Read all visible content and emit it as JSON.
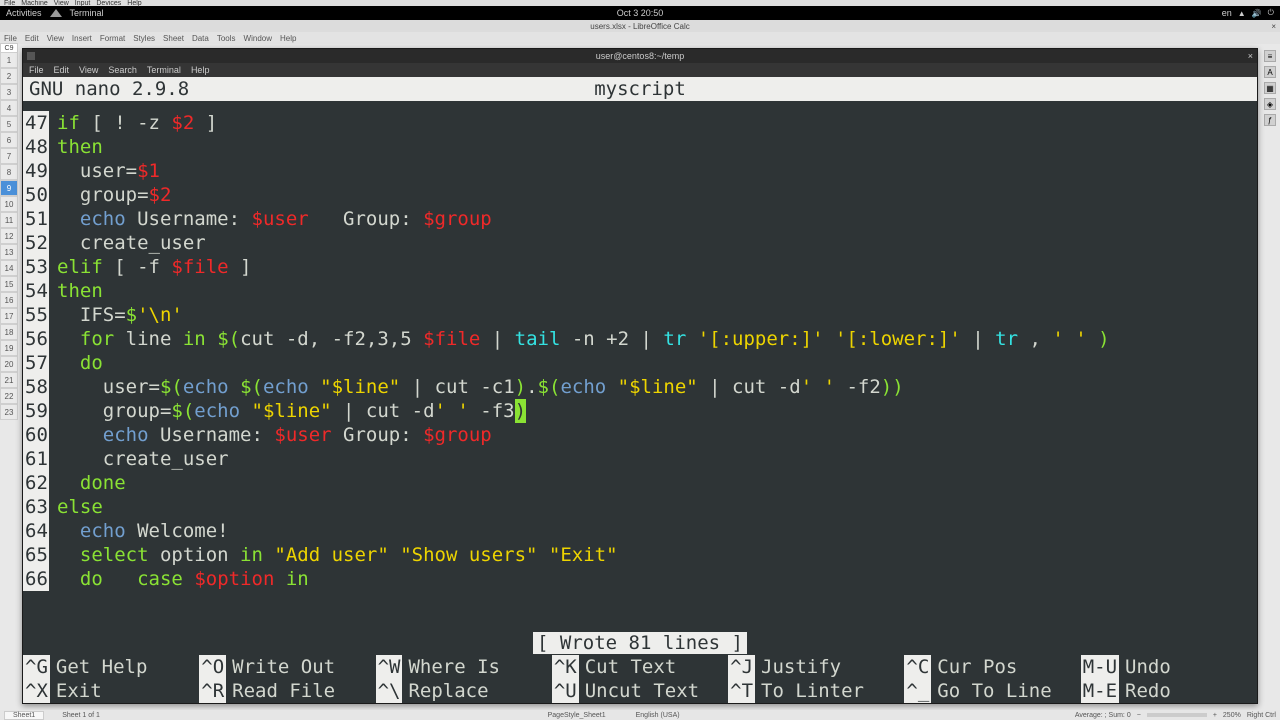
{
  "vm_menu": [
    "File",
    "Machine",
    "View",
    "Input",
    "Devices",
    "Help"
  ],
  "gnome": {
    "activities": "Activities",
    "app": "Terminal",
    "clock": "Oct 3  20:50",
    "lang": "en"
  },
  "libreoffice": {
    "title": "users.xlsx - LibreOffice Calc",
    "menu": [
      "File",
      "Edit",
      "View",
      "Insert",
      "Format",
      "Styles",
      "Sheet",
      "Data",
      "Tools",
      "Window",
      "Help"
    ],
    "cellref": "C9",
    "rows": [
      "1",
      "2",
      "3",
      "4",
      "5",
      "6",
      "7",
      "8",
      "9",
      "10",
      "11",
      "12",
      "13",
      "14",
      "15",
      "16",
      "17",
      "18",
      "19",
      "20",
      "21",
      "22",
      "23"
    ],
    "selected_row": "9"
  },
  "terminal": {
    "title": "user@centos8:~/temp",
    "menu": [
      "File",
      "Edit",
      "View",
      "Search",
      "Terminal",
      "Help"
    ]
  },
  "nano": {
    "app": "GNU nano 2.9.8",
    "filename": "myscript",
    "status": "[ Wrote 81 lines ]",
    "first_line": 47,
    "lines": [
      [
        {
          "t": "if",
          "c": "c-kw"
        },
        {
          "t": " [ ! -z ",
          "c": "c-plain"
        },
        {
          "t": "$2",
          "c": "c-var"
        },
        {
          "t": " ]",
          "c": "c-plain"
        }
      ],
      [
        {
          "t": "then",
          "c": "c-kw"
        }
      ],
      [
        {
          "t": "  user",
          "c": "c-plain"
        },
        {
          "t": "=",
          "c": "c-op"
        },
        {
          "t": "$1",
          "c": "c-var"
        }
      ],
      [
        {
          "t": "  group",
          "c": "c-plain"
        },
        {
          "t": "=",
          "c": "c-op"
        },
        {
          "t": "$2",
          "c": "c-var"
        }
      ],
      [
        {
          "t": "  ",
          "c": "c-plain"
        },
        {
          "t": "echo",
          "c": "c-echo"
        },
        {
          "t": " Username: ",
          "c": "c-plain"
        },
        {
          "t": "$user",
          "c": "c-var"
        },
        {
          "t": "   Group: ",
          "c": "c-plain"
        },
        {
          "t": "$group",
          "c": "c-var"
        }
      ],
      [
        {
          "t": "  create_user",
          "c": "c-plain"
        }
      ],
      [
        {
          "t": "elif",
          "c": "c-kw"
        },
        {
          "t": " [ -f ",
          "c": "c-plain"
        },
        {
          "t": "$file",
          "c": "c-var"
        },
        {
          "t": " ]",
          "c": "c-plain"
        }
      ],
      [
        {
          "t": "then",
          "c": "c-kw"
        }
      ],
      [
        {
          "t": "  IFS=",
          "c": "c-plain"
        },
        {
          "t": "$",
          "c": "c-kw"
        },
        {
          "t": "'\\n'",
          "c": "c-str"
        }
      ],
      [
        {
          "t": "  ",
          "c": "c-plain"
        },
        {
          "t": "for",
          "c": "c-kw"
        },
        {
          "t": " line ",
          "c": "c-plain"
        },
        {
          "t": "in",
          "c": "c-kw"
        },
        {
          "t": " ",
          "c": "c-plain"
        },
        {
          "t": "$(",
          "c": "c-kw"
        },
        {
          "t": "cut -d, -f2,3,5 ",
          "c": "c-plain"
        },
        {
          "t": "$file",
          "c": "c-var"
        },
        {
          "t": " | ",
          "c": "c-plain"
        },
        {
          "t": "tail",
          "c": "c-cyan"
        },
        {
          "t": " -n +2 | ",
          "c": "c-plain"
        },
        {
          "t": "tr",
          "c": "c-cyan"
        },
        {
          "t": " ",
          "c": "c-plain"
        },
        {
          "t": "'[:upper:]' '[:lower:]'",
          "c": "c-str"
        },
        {
          "t": " | ",
          "c": "c-plain"
        },
        {
          "t": "tr",
          "c": "c-cyan"
        },
        {
          "t": " , ",
          "c": "c-plain"
        },
        {
          "t": "' '",
          "c": "c-str"
        },
        {
          "t": " ",
          "c": "c-plain"
        },
        {
          "t": ")",
          "c": "c-kw"
        }
      ],
      [
        {
          "t": "  ",
          "c": "c-plain"
        },
        {
          "t": "do",
          "c": "c-kw"
        }
      ],
      [
        {
          "t": "    user=",
          "c": "c-plain"
        },
        {
          "t": "$(",
          "c": "c-kw"
        },
        {
          "t": "echo",
          "c": "c-echo"
        },
        {
          "t": " ",
          "c": "c-plain"
        },
        {
          "t": "$(",
          "c": "c-kw"
        },
        {
          "t": "echo",
          "c": "c-echo"
        },
        {
          "t": " ",
          "c": "c-plain"
        },
        {
          "t": "\"$line\"",
          "c": "c-str"
        },
        {
          "t": " | cut -c1",
          "c": "c-plain"
        },
        {
          "t": ")",
          "c": "c-kw"
        },
        {
          "t": ".",
          "c": "c-plain"
        },
        {
          "t": "$(",
          "c": "c-kw"
        },
        {
          "t": "echo",
          "c": "c-echo"
        },
        {
          "t": " ",
          "c": "c-plain"
        },
        {
          "t": "\"$line\"",
          "c": "c-str"
        },
        {
          "t": " | cut -d",
          "c": "c-plain"
        },
        {
          "t": "' '",
          "c": "c-str"
        },
        {
          "t": " -f2",
          "c": "c-plain"
        },
        {
          "t": "))",
          "c": "c-kw"
        }
      ],
      [
        {
          "t": "    group=",
          "c": "c-plain"
        },
        {
          "t": "$(",
          "c": "c-kw"
        },
        {
          "t": "echo",
          "c": "c-echo"
        },
        {
          "t": " ",
          "c": "c-plain"
        },
        {
          "t": "\"$line\"",
          "c": "c-str"
        },
        {
          "t": " | cut -d",
          "c": "c-plain"
        },
        {
          "t": "' '",
          "c": "c-str"
        },
        {
          "t": " -f3",
          "c": "c-plain"
        },
        {
          "t": ")",
          "c": "cursor"
        }
      ],
      [
        {
          "t": "    ",
          "c": "c-plain"
        },
        {
          "t": "echo",
          "c": "c-echo"
        },
        {
          "t": " Username: ",
          "c": "c-plain"
        },
        {
          "t": "$user",
          "c": "c-var"
        },
        {
          "t": " Group: ",
          "c": "c-plain"
        },
        {
          "t": "$group",
          "c": "c-var"
        }
      ],
      [
        {
          "t": "    create_user",
          "c": "c-plain"
        }
      ],
      [
        {
          "t": "  ",
          "c": "c-plain"
        },
        {
          "t": "done",
          "c": "c-kw"
        }
      ],
      [
        {
          "t": "else",
          "c": "c-kw"
        }
      ],
      [
        {
          "t": "  ",
          "c": "c-plain"
        },
        {
          "t": "echo",
          "c": "c-echo"
        },
        {
          "t": " Welcome!",
          "c": "c-plain"
        }
      ],
      [
        {
          "t": "  ",
          "c": "c-plain"
        },
        {
          "t": "select",
          "c": "c-kw"
        },
        {
          "t": " option ",
          "c": "c-plain"
        },
        {
          "t": "in",
          "c": "c-kw"
        },
        {
          "t": " ",
          "c": "c-plain"
        },
        {
          "t": "\"Add user\" \"Show users\" \"Exit\"",
          "c": "c-str"
        }
      ],
      [
        {
          "t": "  ",
          "c": "c-plain"
        },
        {
          "t": "do",
          "c": "c-kw"
        },
        {
          "t": "   ",
          "c": "c-plain"
        },
        {
          "t": "case",
          "c": "c-kw"
        },
        {
          "t": " ",
          "c": "c-plain"
        },
        {
          "t": "$option",
          "c": "c-var"
        },
        {
          "t": " ",
          "c": "c-plain"
        },
        {
          "t": "in",
          "c": "c-kw"
        }
      ]
    ],
    "help": [
      [
        {
          "k": "^G",
          "l": "Get Help"
        },
        {
          "k": "^O",
          "l": "Write Out"
        },
        {
          "k": "^W",
          "l": "Where Is"
        },
        {
          "k": "^K",
          "l": "Cut Text"
        },
        {
          "k": "^J",
          "l": "Justify"
        },
        {
          "k": "^C",
          "l": "Cur Pos"
        },
        {
          "k": "M-U",
          "l": "Undo"
        }
      ],
      [
        {
          "k": "^X",
          "l": "Exit"
        },
        {
          "k": "^R",
          "l": "Read File"
        },
        {
          "k": "^\\",
          "l": "Replace"
        },
        {
          "k": "^U",
          "l": "Uncut Text"
        },
        {
          "k": "^T",
          "l": "To Linter"
        },
        {
          "k": "^_",
          "l": "Go To Line"
        },
        {
          "k": "M-E",
          "l": "Redo"
        }
      ]
    ]
  },
  "statusbar": {
    "sheet_label": "Sheet 1 of 1",
    "tab": "Sheet1",
    "pagestyle": "PageStyle_Sheet1",
    "lang": "English (USA)",
    "avg": "Average: ; Sum: 0",
    "zoom": "250%",
    "host": "Right Ctrl"
  }
}
